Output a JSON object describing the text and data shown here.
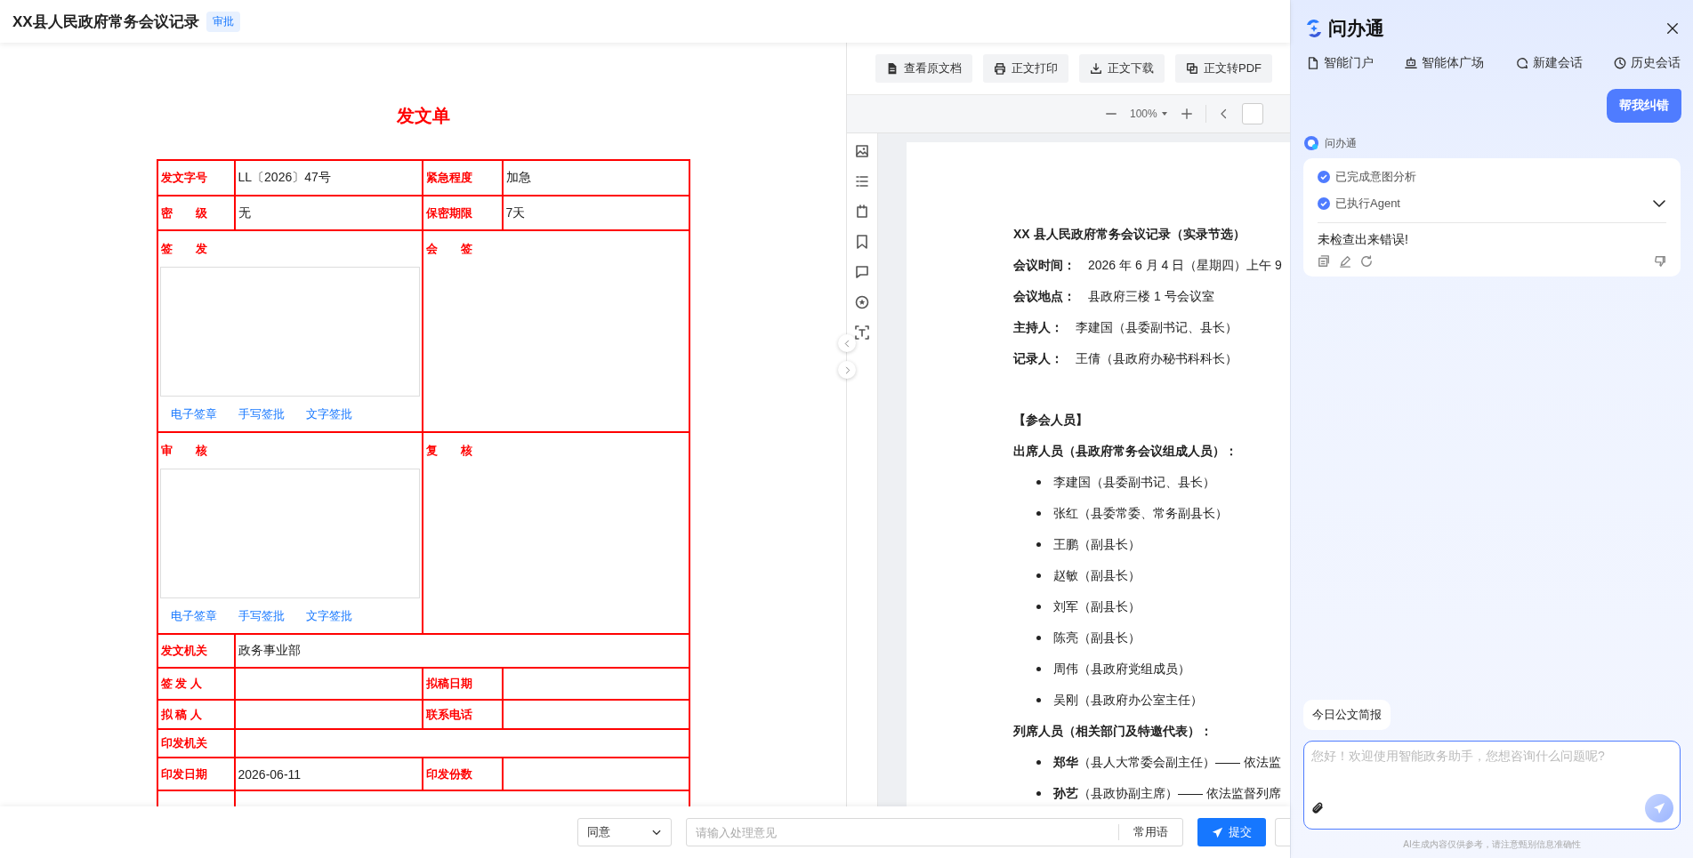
{
  "header": {
    "title": "XX县人民政府常务会议记录",
    "badge": "审批"
  },
  "form": {
    "title": "发文单",
    "rows": [
      {
        "kind": "pair",
        "cells": [
          {
            "label": "发文字号",
            "value": "LL〔2026〕47号"
          },
          {
            "label": "紧急程度",
            "value": "加急"
          }
        ]
      },
      {
        "kind": "pair",
        "cells": [
          {
            "label": "密　　级",
            "value": "无"
          },
          {
            "label": "保密期限",
            "value": "7天"
          }
        ]
      },
      {
        "kind": "sign",
        "halves": [
          {
            "label": "签　　发",
            "actions": [
              "电子签章",
              "手写签批",
              "文字签批"
            ]
          },
          {
            "label": "会　　签"
          }
        ]
      },
      {
        "kind": "sign",
        "halves": [
          {
            "label": "审　　核",
            "actions": [
              "电子签章",
              "手写签批",
              "文字签批"
            ]
          },
          {
            "label": "复　　核"
          }
        ]
      },
      {
        "kind": "wide",
        "label": "发文机关",
        "value": "政务事业部"
      },
      {
        "kind": "pair",
        "cells": [
          {
            "label": "签 发 人"
          },
          {
            "label": "拟稿日期"
          }
        ]
      },
      {
        "kind": "pair",
        "cells": [
          {
            "label": "拟 稿 人"
          },
          {
            "label": "联系电话"
          }
        ]
      },
      {
        "kind": "wide",
        "label": "印发机关"
      },
      {
        "kind": "pair",
        "cells": [
          {
            "label": "印发日期",
            "value": "2026-06-11"
          },
          {
            "label": "印发份数"
          }
        ]
      },
      {
        "kind": "wide"
      }
    ]
  },
  "viewer": {
    "actions": [
      "查看原文档",
      "正文打印",
      "正文下载",
      "正文转PDF"
    ],
    "zoom": "100%",
    "document": {
      "title": "XX 县人民政府常务会议记录（实录节选）",
      "meta": [
        {
          "label": "会议时间：",
          "value": "2026 年 6 月 4 日（星期四）上午 9"
        },
        {
          "label": "会议地点：",
          "value": "县政府三楼 1 号会议室"
        },
        {
          "label": "主持人：",
          "value": "李建国（县委副书记、县长）"
        },
        {
          "label": "记录人：",
          "value": "王倩（县政府办秘书科科长）"
        }
      ],
      "section": "【参会人员】",
      "groups": [
        {
          "heading": "出席人员（县政府常务会议组成人员）：",
          "items": [
            "李建国（县委副书记、县长）",
            "张红（县委常委、常务副县长）",
            "王鹏（副县长）",
            "赵敏（副县长）",
            "刘军（副县长）",
            "陈亮（副县长）",
            "周伟（县政府党组成员）",
            "吴刚（县政府办公室主任）"
          ]
        },
        {
          "heading": "列席人员（相关部门及特邀代表）：",
          "items": [
            "**郑华**（县人大常委会副主任）—— 依法监",
            "**孙艺**（县政协副主席）—— 依法监督列席"
          ]
        }
      ]
    }
  },
  "action_bar": {
    "decision": "同意",
    "opinion_placeholder": "请输入处理意见",
    "phrases": "常用语",
    "submit": "提交"
  },
  "assistant": {
    "brand": "问办通",
    "nav": [
      "智能门户",
      "智能体广场",
      "新建会话",
      "历史会话"
    ],
    "user_message": "帮我纠错",
    "bot_name": "问办通",
    "steps": [
      {
        "text": "已完成意图分析",
        "done": true
      },
      {
        "text": "已执行Agent",
        "done": true
      }
    ],
    "steps_expanded": false,
    "answer": "未检查出来错误!",
    "quick_prompts": [
      "今日公文简报"
    ],
    "input_placeholder": "您好！欢迎使用智能政务助手，您想咨询什么问题呢?",
    "disclaimer": "AI生成内容仅供参考，请注意甄别信息准确性"
  }
}
